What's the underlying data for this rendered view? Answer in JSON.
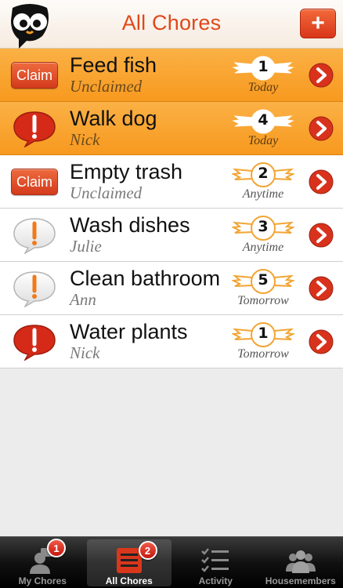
{
  "header": {
    "title": "All Chores",
    "add_label": "+",
    "logo_icon": "owl-logo-icon"
  },
  "colors": {
    "accent": "#e0481b",
    "mine_row": "#f9a531",
    "badge_red": "#d32b1c",
    "outline_orange": "#f2a533"
  },
  "chores": [
    {
      "name": "Feed fish",
      "assignee": "Unclaimed",
      "points": "1",
      "due": "Today",
      "status": "claim",
      "claim_label": "Claim",
      "mine": true
    },
    {
      "name": "Walk dog",
      "assignee": "Nick",
      "points": "4",
      "due": "Today",
      "status": "alert-red",
      "mine": true
    },
    {
      "name": "Empty trash",
      "assignee": "Unclaimed",
      "points": "2",
      "due": "Anytime",
      "status": "claim",
      "claim_label": "Claim",
      "mine": false
    },
    {
      "name": "Wash dishes",
      "assignee": "Julie",
      "points": "3",
      "due": "Anytime",
      "status": "alert-white",
      "mine": false
    },
    {
      "name": "Clean bathroom",
      "assignee": "Ann",
      "points": "5",
      "due": "Tomorrow",
      "status": "alert-white",
      "mine": false
    },
    {
      "name": "Water plants",
      "assignee": "Nick",
      "points": "1",
      "due": "Tomorrow",
      "status": "alert-red",
      "mine": false
    }
  ],
  "tabs": [
    {
      "label": "My Chores",
      "icon": "person-chat-icon",
      "badge": "1",
      "active": false
    },
    {
      "label": "All Chores",
      "icon": "list-icon",
      "badge": "2",
      "active": true
    },
    {
      "label": "Activity",
      "icon": "checklist-icon",
      "badge": "",
      "active": false
    },
    {
      "label": "Housemembers",
      "icon": "group-icon",
      "badge": "",
      "active": false
    }
  ]
}
